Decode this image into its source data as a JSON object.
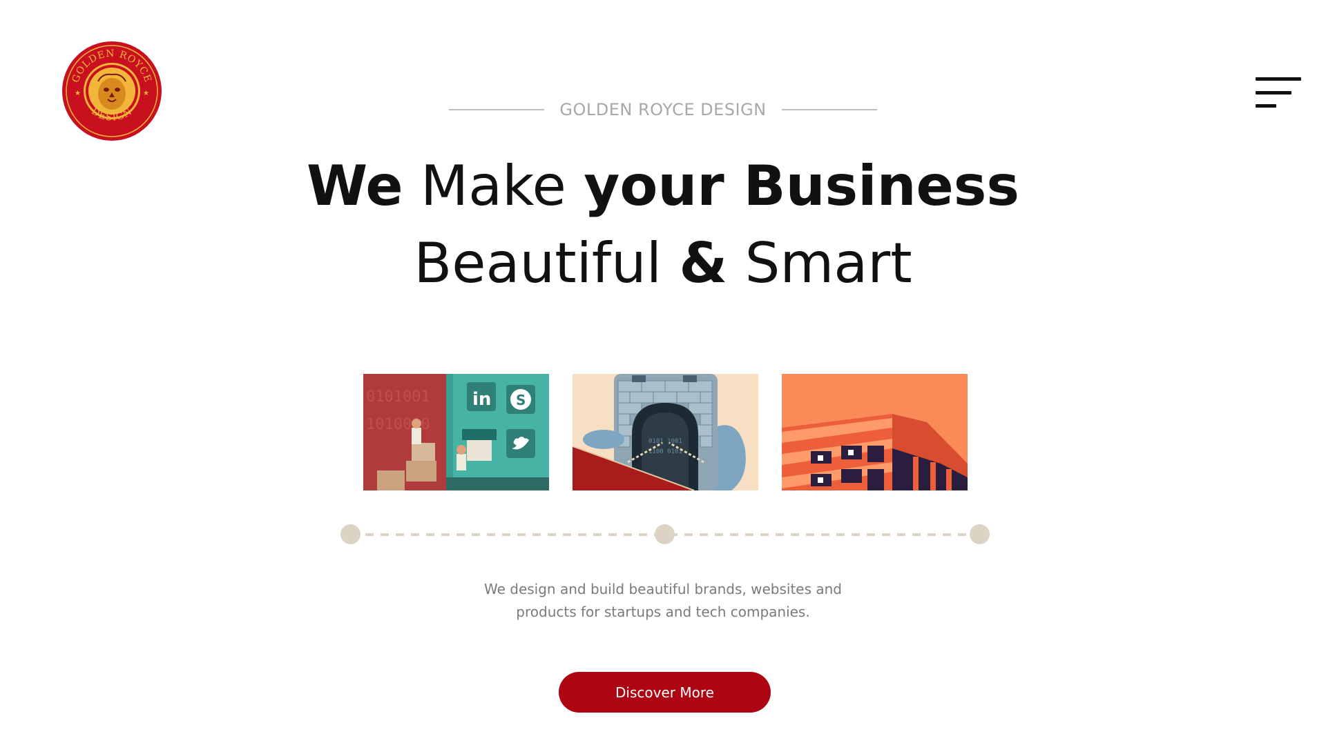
{
  "brand": {
    "logo_text_top": "GOLDEN ROYCE",
    "logo_text_bottom": "DESIGN",
    "eyebrow": "GOLDEN ROYCE DESIGN"
  },
  "headline": {
    "line1": [
      {
        "text": "We",
        "weight": "bold"
      },
      {
        "text": " Make ",
        "weight": "light"
      },
      {
        "text": "your Business",
        "weight": "bold"
      }
    ],
    "line2": [
      {
        "text": "Beautiful ",
        "weight": "light"
      },
      {
        "text": "&",
        "weight": "bold"
      },
      {
        "text": " Smart",
        "weight": "light"
      }
    ]
  },
  "cards": [
    {
      "name": "social-media-illustration"
    },
    {
      "name": "security-phone-illustration"
    },
    {
      "name": "architecture-illustration"
    }
  ],
  "description": {
    "line1": "We design and build beautiful brands, websites and",
    "line2": "products for startups and tech companies."
  },
  "cta": {
    "label": "Discover More"
  },
  "icons": {
    "menu": "hamburger-menu-icon",
    "linkedin": "linkedin-icon",
    "skype": "skype-icon",
    "twitter": "twitter-icon"
  },
  "colors": {
    "accent": "#ad0612",
    "logo_red": "#c8101e",
    "logo_gold": "#f2b63a",
    "timeline": "#dcd3c4",
    "text_dark": "#111111",
    "text_muted": "#7a7a7a"
  }
}
